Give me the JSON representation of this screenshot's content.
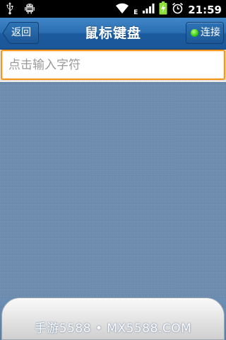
{
  "status_bar": {
    "time": "21:59",
    "network_label": "E",
    "icons": [
      "usb-icon",
      "android-debug-icon",
      "wifi-icon",
      "signal-icon",
      "battery-charging-icon",
      "alarm-icon"
    ]
  },
  "header": {
    "title": "鼠标键盘",
    "back_label": "返回",
    "connect_label": "连接",
    "connect_status_color": "#3fd11a",
    "bar_color": "#2c6fb4"
  },
  "input": {
    "value": "",
    "placeholder": "点击输入字符",
    "border_color": "#f5961e"
  },
  "touchpad": {
    "color": "#6d8eb3"
  },
  "watermark": {
    "text": "手游5588 • MX5588.COM"
  }
}
